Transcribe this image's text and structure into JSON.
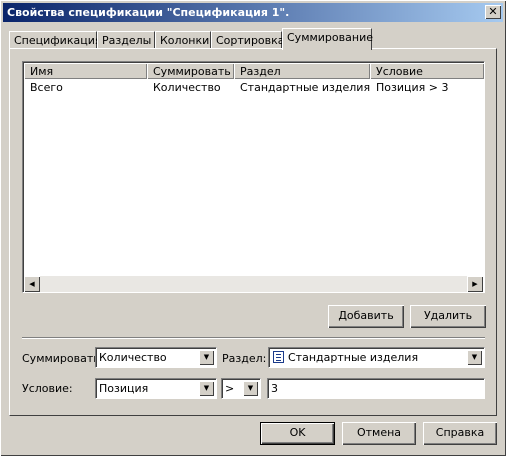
{
  "window": {
    "title": "Свойства спецификации \"Спецификация 1\".",
    "close_glyph": "✕"
  },
  "tabs": [
    {
      "label": "Спецификация"
    },
    {
      "label": "Разделы"
    },
    {
      "label": "Колонки"
    },
    {
      "label": "Сортировка"
    },
    {
      "label": "Суммирование",
      "active": true
    }
  ],
  "list": {
    "columns": [
      "Имя",
      "Суммировать",
      "Раздел",
      "Условие"
    ],
    "rows": [
      [
        "Всего",
        "Количество",
        "Стандартные изделия",
        "Позиция > 3"
      ]
    ],
    "scroll_left_glyph": "◀",
    "scroll_right_glyph": "▶"
  },
  "list_buttons": {
    "add": "Добавить",
    "remove": "Удалить"
  },
  "form": {
    "sum_label": "Суммировать:",
    "sum_value": "Количество",
    "section_label": "Раздел:",
    "section_value": "Стандартные изделия",
    "condition_label": "Условие:",
    "condition_field": "Позиция",
    "condition_operator": ">",
    "condition_value": "3",
    "dropdown_glyph": "▼"
  },
  "footer": {
    "ok": "OK",
    "cancel": "Отмена",
    "help": "Справка"
  }
}
